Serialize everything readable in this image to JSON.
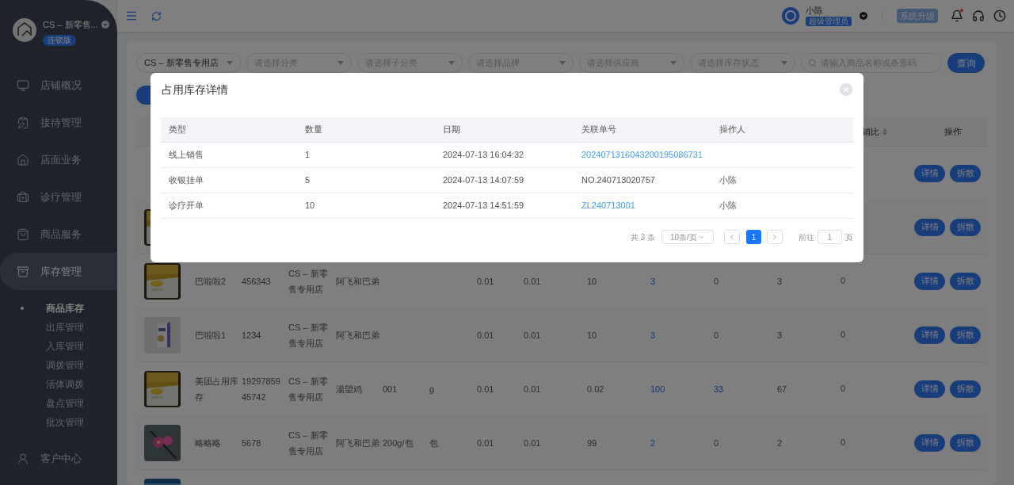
{
  "sidebar": {
    "store_name": "CS – 新零售...",
    "edition": "连锁版",
    "items": [
      {
        "label": "店铺概况",
        "selected": false
      },
      {
        "label": "接待管理",
        "selected": false
      },
      {
        "label": "店面业务",
        "selected": false
      },
      {
        "label": "诊疗管理",
        "selected": false
      },
      {
        "label": "商品服务",
        "selected": false
      },
      {
        "label": "库存管理",
        "selected": true,
        "expanded": true,
        "children": [
          {
            "label": "商品库存",
            "selected": true
          },
          {
            "label": "出库管理",
            "selected": false
          },
          {
            "label": "入库管理",
            "selected": false
          },
          {
            "label": "调拨管理",
            "selected": false
          },
          {
            "label": "活体调拨",
            "selected": false
          },
          {
            "label": "盘点管理",
            "selected": false
          },
          {
            "label": "批次管理",
            "selected": false
          }
        ]
      },
      {
        "label": "客户中心",
        "selected": false
      }
    ]
  },
  "topbar": {
    "user_name": "小陈",
    "role": "超级管理员",
    "upgrade_button": "系统升级",
    "unread_notifications": true
  },
  "filters": {
    "store": "CS – 新零售专用店",
    "selects": [
      "请选择分类",
      "请选择子分类",
      "请选择品牌",
      "请选择供应商",
      "请选择库存状态"
    ],
    "search_placeholder": "请输入商品名称或条形码",
    "query_button": "查询"
  },
  "product_table": {
    "columns": [
      {
        "label": "销比",
        "sortable": true
      },
      {
        "label": "操作",
        "sortable": false
      }
    ],
    "rows": [
      {
        "actions": [
          "详情",
          "拆散"
        ]
      },
      {
        "image": {
          "kind": "picture"
        },
        "actions": [
          "详情",
          "拆散"
        ]
      },
      {
        "image": {
          "kind": "picture"
        },
        "cells": {
          "column_2": {
            "text": "巴啦啦2",
            "link": false
          },
          "column_3": {
            "text": "456343",
            "link": false
          },
          "column_4": {
            "text": "CS – 新零售专用店",
            "link": false
          },
          "column_5": {
            "text": "阿飞和巴弟",
            "link": false
          },
          "column_8": {
            "text": "0.01",
            "link": false
          },
          "column_9": {
            "text": "0.01",
            "link": false
          },
          "column_10": {
            "text": "10",
            "link": false
          },
          "column_11": {
            "text": "3",
            "link": true
          },
          "column_12": {
            "text": "0",
            "link": false
          },
          "column_13": {
            "text": "3",
            "link": false
          },
          "column_14": {
            "text": "0",
            "link": false
          }
        },
        "actions": [
          "详情",
          "拆散"
        ]
      },
      {
        "image": {
          "kind": "picture"
        },
        "cells": {
          "column_2": {
            "text": "巴啦啦1",
            "link": false
          },
          "column_3": {
            "text": "1234",
            "link": false
          },
          "column_4": {
            "text": "CS – 新零售专用店",
            "link": false
          },
          "column_5": {
            "text": "阿飞和巴弟",
            "link": false
          },
          "column_8": {
            "text": "0.01",
            "link": false
          },
          "column_9": {
            "text": "0.01",
            "link": false
          },
          "column_10": {
            "text": "10",
            "link": false
          },
          "column_11": {
            "text": "3",
            "link": true
          },
          "column_12": {
            "text": "0",
            "link": false
          },
          "column_13": {
            "text": "3",
            "link": false
          },
          "column_14": {
            "text": "0",
            "link": false
          }
        },
        "actions": [
          "详情",
          "拆散"
        ]
      },
      {
        "image": {
          "kind": "picture"
        },
        "cells": {
          "column_2": {
            "text": "美团占用库存",
            "link": false
          },
          "column_3": {
            "text": "1929785945742",
            "link": false
          },
          "column_4": {
            "text": "CS – 新零售专用店",
            "link": false
          },
          "column_5": {
            "text": "湯望鸡",
            "link": false
          },
          "column_6": {
            "text": "001",
            "link": false
          },
          "column_7": {
            "text": "g",
            "link": false
          },
          "column_8": {
            "text": "0.01",
            "link": false
          },
          "column_9": {
            "text": "0.01",
            "link": false
          },
          "column_10": {
            "text": "0.02",
            "link": false
          },
          "column_11": {
            "text": "100",
            "link": true
          },
          "column_12": {
            "text": "33",
            "link": true
          },
          "column_13": {
            "text": "67",
            "link": false
          },
          "column_14": {
            "text": "0",
            "link": false
          }
        },
        "actions": [
          "详情",
          "拆散"
        ]
      },
      {
        "image": {
          "kind": "picture"
        },
        "cells": {
          "column_2": {
            "text": "略略略",
            "link": false
          },
          "column_3": {
            "text": "5678",
            "link": false
          },
          "column_4": {
            "text": "CS – 新零售专用店",
            "link": false
          },
          "column_5": {
            "text": "阿飞和巴弟",
            "link": false
          },
          "column_6": {
            "text": "200g/包",
            "link": false
          },
          "column_7": {
            "text": "包",
            "link": false
          },
          "column_8": {
            "text": "0.01",
            "link": false
          },
          "column_9": {
            "text": "0.01",
            "link": false
          },
          "column_10": {
            "text": "99",
            "link": false
          },
          "column_11": {
            "text": "2",
            "link": true
          },
          "column_12": {
            "text": "0",
            "link": false
          },
          "column_13": {
            "text": "2",
            "link": false
          },
          "column_14": {
            "text": "0",
            "link": false
          }
        },
        "actions": [
          "详情",
          "拆散"
        ]
      },
      {
        "image": {
          "kind": "picture"
        }
      }
    ]
  },
  "dialog": {
    "title": "占用库存详情",
    "columns": [
      "类型",
      "数量",
      "日期",
      "关联单号",
      "操作人"
    ],
    "rows": [
      {
        "cells": [
          {
            "text": "线上销售",
            "link": false
          },
          {
            "text": "1",
            "link": false
          },
          {
            "text": "2024-07-13 16:04:32",
            "link": false
          },
          {
            "text": "2024071316043200195086731",
            "link": true
          }
        ]
      },
      {
        "cells": [
          {
            "text": "收银挂单",
            "link": false
          },
          {
            "text": "5",
            "link": false
          },
          {
            "text": "2024-07-13 14:07:59",
            "link": false
          },
          {
            "text": "NO.240713020757",
            "link": false
          },
          {
            "text": "小陈",
            "link": false
          }
        ]
      },
      {
        "cells": [
          {
            "text": "诊疗开单",
            "link": false
          },
          {
            "text": "10",
            "link": false
          },
          {
            "text": "2024-07-13 14:51:59",
            "link": false
          },
          {
            "text": "ZL240713001",
            "link": true
          },
          {
            "text": "小陈",
            "link": false
          }
        ]
      }
    ],
    "pagination": {
      "total": "共 3 条",
      "page_size": "10条/页",
      "pages": [
        {
          "label": "1",
          "selected": true
        }
      ],
      "goto_label": "前往",
      "goto_value": "1",
      "goto_suffix": "页"
    }
  }
}
